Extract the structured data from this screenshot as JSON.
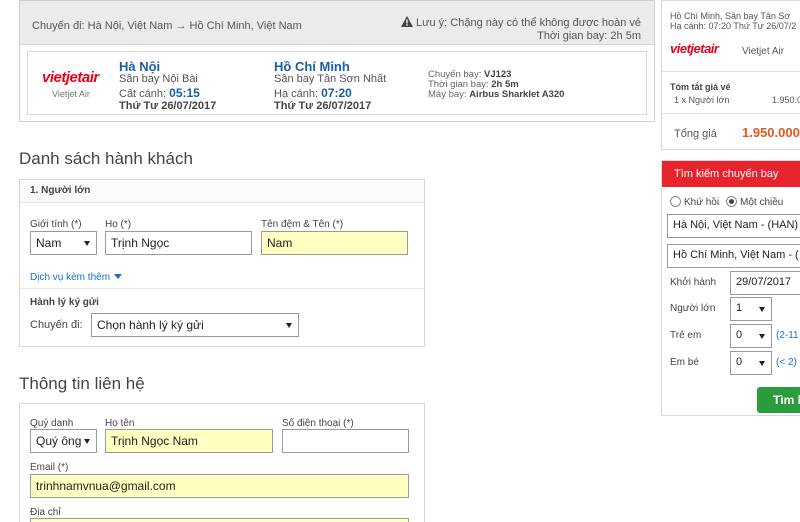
{
  "flight": {
    "route": "Chuyến đi: Hà Nội, Việt Nam → Hồ Chí Minh, Việt Nam",
    "notice_line1": "Lưu ý: Chặng này có thể không được hoàn vé",
    "notice_line2": "Thời gian bay: 2h 5m",
    "airline_logo": "vietjetair",
    "airline_name": "Vietjet Air",
    "depart_city": "Hà Nội",
    "depart_airport": "Sân bay Nội Bài",
    "depart_label": "Cất cánh:",
    "depart_time": "05:15",
    "depart_date": "Thứ Tư 26/07/2017",
    "arrive_city": "Hồ Chí Minh",
    "arrive_airport": "Sân bay Tân Sơn Nhất",
    "arrive_label": "Hạ cánh:",
    "arrive_time": "07:20",
    "arrive_date": "Thứ Tư 26/07/2017",
    "flight_no_label": "Chuyến bay:",
    "flight_no": "VJ123",
    "duration_label": "Thời gian bay:",
    "duration": "2h 5m",
    "aircraft_label": "Máy bay:",
    "aircraft": "Airbus Sharklet A320"
  },
  "passengers": {
    "title": "Danh sách hành khách",
    "panel_title": "1. Người lớn",
    "gender_label": "Giới tính (*)",
    "gender_value": "Nam",
    "lastname_label": "Họ (*)",
    "lastname_value": "Trịnh Ngọc",
    "firstname_label": "Tên đệm & Tên (*)",
    "firstname_value": "Nam",
    "extra_services": "Dịch vụ kèm thêm",
    "baggage_title": "Hành lý ký gửi",
    "baggage_trip_label": "Chuyến đi:",
    "baggage_select": "Chọn hành lý ký gửi"
  },
  "contact": {
    "title": "Thông tin liên hệ",
    "title_label": "Quý danh",
    "title_value": "Quý ông",
    "fullname_label": "Họ tên",
    "fullname_value": "Trịnh Ngọc Nam",
    "phone_label": "Số điện thoại (*)",
    "phone_value": "",
    "email_label": "Email (*)",
    "email_value": "trinhnamvnua@gmail.com",
    "address_label": "Địa chỉ"
  },
  "summary": {
    "route_line1": "Hồ Chí Minh, Sân bay Tân Sơ",
    "route_line2": "Hạ cánh: 07:20 Thứ Tư 26/07/2",
    "airline_name": "Vietjet Air",
    "fare_title": "Tóm tắt giá vé",
    "fare_item": "1 x Người lớn",
    "fare_item_value": "1.950.0",
    "total_label": "Tổng giá",
    "total_value": "1.950.000"
  },
  "search": {
    "title": "Tìm kiếm chuyến bay",
    "roundtrip": "Khứ hồi",
    "oneway": "Một chiều",
    "from": "Hà Nội, Việt Nam - (HAN)",
    "to": "Hồ Chí Minh, Việt Nam - (",
    "depart_label": "Khởi hành",
    "depart_value": "29/07/2017",
    "adult_label": "Người lớn",
    "adult_value": "1",
    "child_label": "Trẻ em",
    "child_value": "0",
    "child_hint": "(2-11",
    "infant_label": "Em bé",
    "infant_value": "0",
    "infant_hint": "(< 2)",
    "button": "Tìm k"
  },
  "colors": {
    "brand_red": "#e8001c",
    "link_blue": "#1a5dab",
    "highlight_yellow": "#ffffc2",
    "search_red": "#e7242e",
    "button_green": "#2a9c3e",
    "total_orange": "#e8561a"
  }
}
